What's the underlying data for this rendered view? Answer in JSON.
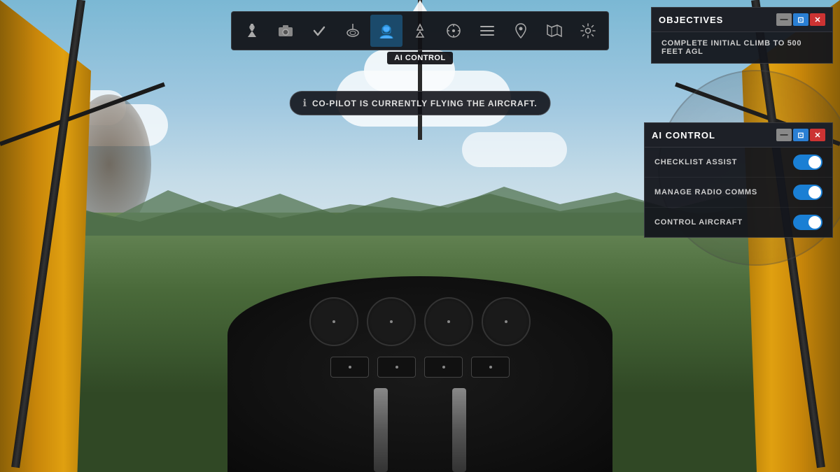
{
  "toolbar": {
    "buttons": [
      {
        "id": "atc",
        "icon": "🗼",
        "label": "ATC",
        "active": false
      },
      {
        "id": "camera",
        "icon": "📷",
        "label": "Camera",
        "active": false
      },
      {
        "id": "checklist",
        "icon": "✓",
        "label": "Checklist",
        "active": false
      },
      {
        "id": "navaids",
        "icon": "⚙",
        "label": "Navaids",
        "active": false
      },
      {
        "id": "ai-control",
        "icon": "👤",
        "label": "AI Control",
        "active": true
      },
      {
        "id": "weather",
        "icon": "⛰",
        "label": "Weather",
        "active": false
      },
      {
        "id": "compass",
        "icon": "⊕",
        "label": "Compass",
        "active": false
      },
      {
        "id": "missions",
        "icon": "☰",
        "label": "Missions",
        "active": false
      },
      {
        "id": "waypoints",
        "icon": "📍",
        "label": "Waypoints",
        "active": false
      },
      {
        "id": "map",
        "icon": "🗺",
        "label": "Map",
        "active": false
      },
      {
        "id": "settings",
        "icon": "⚙",
        "label": "Settings",
        "active": false
      }
    ],
    "active_label": "AI CONTROL"
  },
  "copilot_notification": {
    "icon": "ℹ",
    "text": "CO-PILOT IS CURRENTLY FLYING THE AIRCRAFT."
  },
  "ai_control_panel": {
    "title": "AI CONTROL",
    "minimize_label": "—",
    "restore_label": "⊡",
    "close_label": "✕",
    "rows": [
      {
        "id": "checklist-assist",
        "label": "CHECKLIST ASSIST",
        "enabled": true
      },
      {
        "id": "manage-radio",
        "label": "MANAGE RADIO COMMS",
        "enabled": true
      },
      {
        "id": "control-aircraft",
        "label": "CONTROL AIRCRAFT",
        "enabled": true
      }
    ]
  },
  "objectives_panel": {
    "title": "OBJECTIVES",
    "minimize_label": "—",
    "restore_label": "⊡",
    "close_label": "✕",
    "objective_text": "COMPLETE INITIAL CLIMB TO 500 FEET AGL"
  }
}
